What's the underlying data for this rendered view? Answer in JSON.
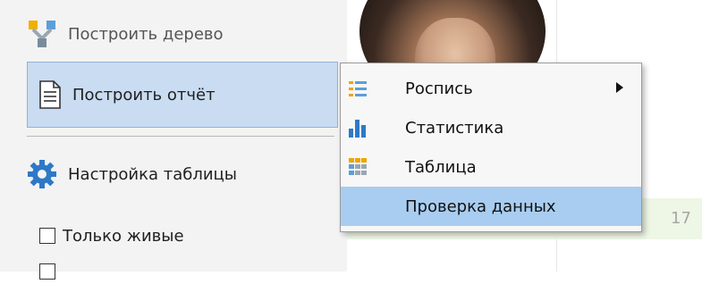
{
  "sidebar": {
    "build_tree_label": "Построить дерево",
    "build_report_label": "Построить отчёт",
    "table_settings_label": "Настройка таблицы",
    "only_living_label": "Только живые",
    "second_checkbox_label": ""
  },
  "context_menu": {
    "items": [
      {
        "label": "Роспись",
        "icon": "list-icon",
        "has_submenu": true
      },
      {
        "label": "Статистика",
        "icon": "bar-chart-icon",
        "has_submenu": false
      },
      {
        "label": "Таблица",
        "icon": "table-icon",
        "has_submenu": false
      },
      {
        "label": "Проверка данных",
        "icon": "",
        "has_submenu": false
      }
    ]
  },
  "grid": {
    "row_number": "17"
  },
  "colors": {
    "selected_bg": "#c9dcf1",
    "menu_highlight": "#a8cdf0",
    "gear_blue": "#2e79c7",
    "row_green": "#eef6e6"
  }
}
